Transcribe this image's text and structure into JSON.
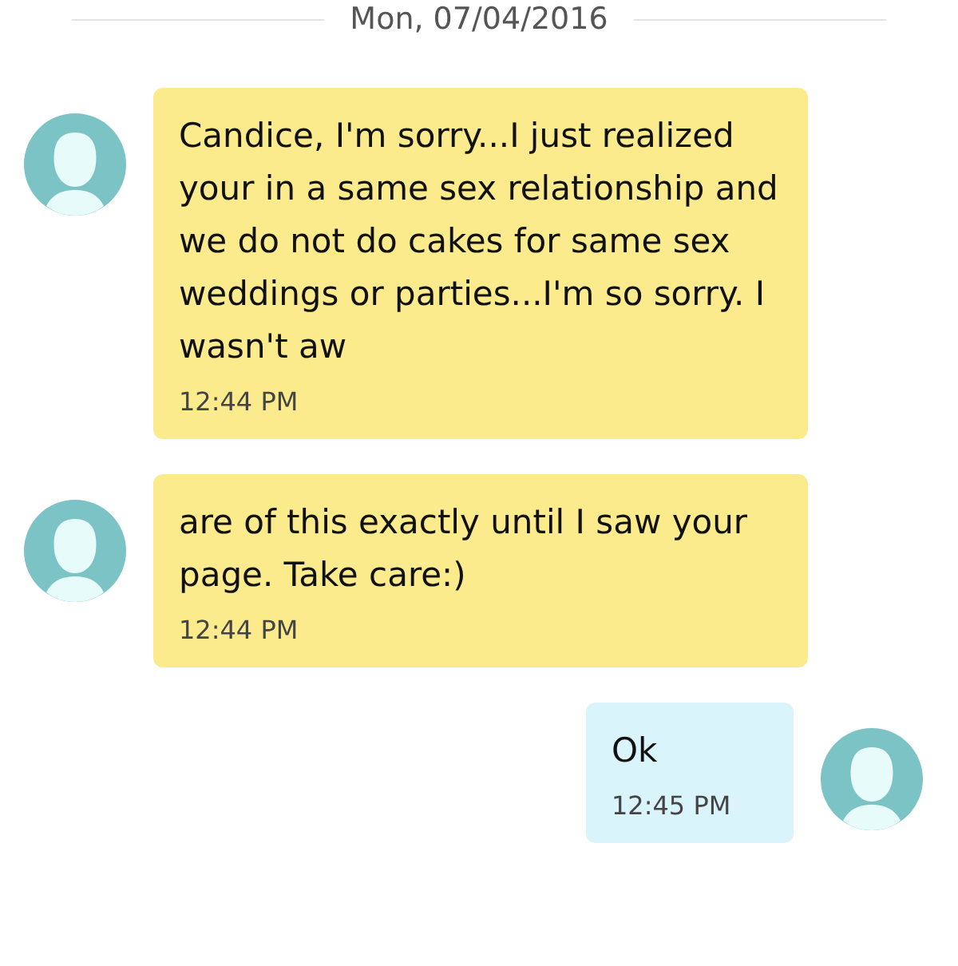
{
  "date_header": "Mon, 07/04/2016",
  "messages": [
    {
      "kind": "incoming",
      "text": "Candice, I'm sorry...I just realized your in a same sex relationship and we do not do cakes for same sex weddings or parties...I'm so sorry. I wasn't aw",
      "time": "12:44 PM"
    },
    {
      "kind": "incoming",
      "text": "are of this exactly until I saw your page. Take care:)",
      "time": "12:44 PM"
    },
    {
      "kind": "outgoing",
      "text": "Ok",
      "time": "12:45 PM"
    }
  ]
}
